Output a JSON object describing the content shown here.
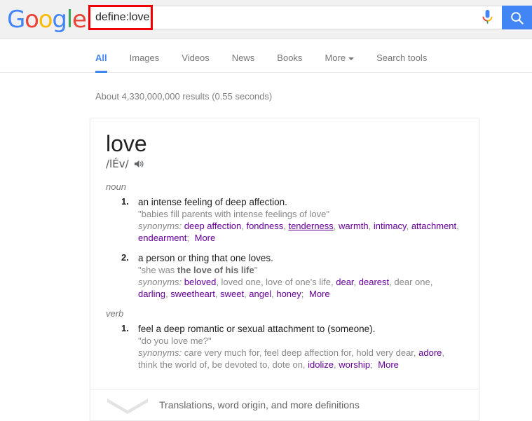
{
  "header": {
    "logo": [
      {
        "ch": "G",
        "color": "#4285f4"
      },
      {
        "ch": "o",
        "color": "#ea4335"
      },
      {
        "ch": "o",
        "color": "#fbbc05"
      },
      {
        "ch": "g",
        "color": "#4285f4"
      },
      {
        "ch": "l",
        "color": "#34a853"
      },
      {
        "ch": "e",
        "color": "#ea4335"
      }
    ],
    "logo_text": "Google",
    "search": {
      "value": "define:love",
      "placeholder": "Search",
      "mic_icon": "microphone-icon",
      "search_icon": "search-icon",
      "highlight_color": "#ee0000"
    }
  },
  "nav": {
    "tabs": [
      {
        "label": "All",
        "active": true
      },
      {
        "label": "Images",
        "active": false
      },
      {
        "label": "Videos",
        "active": false
      },
      {
        "label": "News",
        "active": false
      },
      {
        "label": "Books",
        "active": false
      },
      {
        "label": "More",
        "active": false,
        "caret": true
      },
      {
        "label": "Search tools",
        "active": false
      }
    ],
    "active_color": "#4285f4"
  },
  "results": {
    "stats": "About 4,330,000,000 results (0.55 seconds)"
  },
  "dictionary": {
    "word": "love",
    "phonetic": "/lÉv/",
    "speaker_icon": "speaker-icon",
    "synonyms_label": "synonyms:",
    "more_label": "More",
    "entries": [
      {
        "part_of_speech": "noun",
        "senses": [
          {
            "number": "1.",
            "definition": "an intense feeling of deep affection.",
            "example": "\"babies fill parents with intense feelings of love\"",
            "example_bold": "",
            "synonyms": [
              {
                "text": "deep affection",
                "link": true,
                "hover": false
              },
              {
                "text": "fondness",
                "link": true,
                "hover": false
              },
              {
                "text": "tenderness",
                "link": true,
                "hover": true
              },
              {
                "text": "warmth",
                "link": true,
                "hover": false
              },
              {
                "text": "intimacy",
                "link": true,
                "hover": false
              },
              {
                "text": "attachment",
                "link": true,
                "hover": false
              },
              {
                "text": "endearment",
                "link": true,
                "hover": false
              }
            ]
          },
          {
            "number": "2.",
            "definition": "a person or thing that one loves.",
            "example": "\"she was ",
            "example_bold": "the love of his life",
            "example_tail": "\"",
            "synonyms": [
              {
                "text": "beloved",
                "link": true,
                "hover": false
              },
              {
                "text": "loved one",
                "link": false,
                "hover": false
              },
              {
                "text": "love of one's life",
                "link": false,
                "hover": false
              },
              {
                "text": "dear",
                "link": true,
                "hover": false
              },
              {
                "text": "dearest",
                "link": true,
                "hover": false
              },
              {
                "text": "dear one",
                "link": false,
                "hover": false
              },
              {
                "text": "darling",
                "link": true,
                "hover": false
              },
              {
                "text": "sweetheart",
                "link": true,
                "hover": false
              },
              {
                "text": "sweet",
                "link": true,
                "hover": false
              },
              {
                "text": "angel",
                "link": true,
                "hover": false
              },
              {
                "text": "honey",
                "link": true,
                "hover": false
              }
            ]
          }
        ]
      },
      {
        "part_of_speech": "verb",
        "senses": [
          {
            "number": "1.",
            "definition": "feel a deep romantic or sexual attachment to (someone).",
            "example": "\"do you love me?\"",
            "example_bold": "",
            "synonyms": [
              {
                "text": "care very much for",
                "link": false,
                "hover": false
              },
              {
                "text": "feel deep affection for",
                "link": false,
                "hover": false
              },
              {
                "text": "hold very dear",
                "link": false,
                "hover": false
              },
              {
                "text": "adore",
                "link": true,
                "hover": false
              },
              {
                "text": "think the world of",
                "link": false,
                "hover": false
              },
              {
                "text": "be devoted to",
                "link": false,
                "hover": false
              },
              {
                "text": "dote on",
                "link": false,
                "hover": false
              },
              {
                "text": "idolize",
                "link": true,
                "hover": false
              },
              {
                "text": "worship",
                "link": true,
                "hover": false
              }
            ]
          }
        ]
      }
    ],
    "footer": {
      "label": "Translations, word origin, and more definitions",
      "icon": "chevron-down-icon"
    },
    "link_color": "#660099"
  }
}
